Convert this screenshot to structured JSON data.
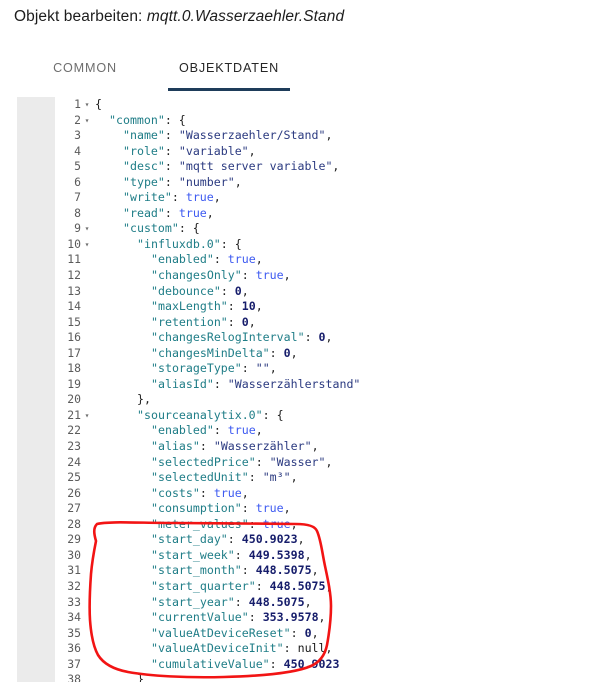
{
  "dialog": {
    "title_prefix": "Objekt bearbeiten:",
    "object_id": "mqtt.0.Wasserzaehler.Stand"
  },
  "tabs": [
    {
      "label": "COMMON",
      "active": false
    },
    {
      "label": "OBJEKTDATEN",
      "active": true
    }
  ],
  "colors": {
    "accent_underline": "#1e3c5a",
    "annotation_red": "#f21414",
    "gutter_bg": "#ebebeb",
    "json_key": "#1f7d87",
    "json_string": "#2b3a80",
    "json_number": "#161d6b",
    "json_boolean": "#3d5af1"
  },
  "editor": {
    "language": "json",
    "line_count": 38,
    "lines": [
      {
        "n": 1,
        "fold": true,
        "indent": 0,
        "tokens": [
          {
            "t": "punct",
            "v": "{"
          }
        ]
      },
      {
        "n": 2,
        "fold": true,
        "indent": 1,
        "tokens": [
          {
            "t": "key",
            "v": "\"common\""
          },
          {
            "t": "punct",
            "v": ": {"
          }
        ]
      },
      {
        "n": 3,
        "fold": false,
        "indent": 2,
        "tokens": [
          {
            "t": "key",
            "v": "\"name\""
          },
          {
            "t": "punct",
            "v": ": "
          },
          {
            "t": "str",
            "v": "\"Wasserzaehler/Stand\""
          },
          {
            "t": "punct",
            "v": ","
          }
        ]
      },
      {
        "n": 4,
        "fold": false,
        "indent": 2,
        "tokens": [
          {
            "t": "key",
            "v": "\"role\""
          },
          {
            "t": "punct",
            "v": ": "
          },
          {
            "t": "str",
            "v": "\"variable\""
          },
          {
            "t": "punct",
            "v": ","
          }
        ]
      },
      {
        "n": 5,
        "fold": false,
        "indent": 2,
        "tokens": [
          {
            "t": "key",
            "v": "\"desc\""
          },
          {
            "t": "punct",
            "v": ": "
          },
          {
            "t": "str",
            "v": "\"mqtt server variable\""
          },
          {
            "t": "punct",
            "v": ","
          }
        ]
      },
      {
        "n": 6,
        "fold": false,
        "indent": 2,
        "tokens": [
          {
            "t": "key",
            "v": "\"type\""
          },
          {
            "t": "punct",
            "v": ": "
          },
          {
            "t": "str",
            "v": "\"number\""
          },
          {
            "t": "punct",
            "v": ","
          }
        ]
      },
      {
        "n": 7,
        "fold": false,
        "indent": 2,
        "tokens": [
          {
            "t": "key",
            "v": "\"write\""
          },
          {
            "t": "punct",
            "v": ": "
          },
          {
            "t": "bool",
            "v": "true"
          },
          {
            "t": "punct",
            "v": ","
          }
        ]
      },
      {
        "n": 8,
        "fold": false,
        "indent": 2,
        "tokens": [
          {
            "t": "key",
            "v": "\"read\""
          },
          {
            "t": "punct",
            "v": ": "
          },
          {
            "t": "bool",
            "v": "true"
          },
          {
            "t": "punct",
            "v": ","
          }
        ]
      },
      {
        "n": 9,
        "fold": true,
        "indent": 2,
        "tokens": [
          {
            "t": "key",
            "v": "\"custom\""
          },
          {
            "t": "punct",
            "v": ": {"
          }
        ]
      },
      {
        "n": 10,
        "fold": true,
        "indent": 3,
        "tokens": [
          {
            "t": "key",
            "v": "\"influxdb.0\""
          },
          {
            "t": "punct",
            "v": ": {"
          }
        ]
      },
      {
        "n": 11,
        "fold": false,
        "indent": 4,
        "tokens": [
          {
            "t": "key",
            "v": "\"enabled\""
          },
          {
            "t": "punct",
            "v": ": "
          },
          {
            "t": "bool",
            "v": "true"
          },
          {
            "t": "punct",
            "v": ","
          }
        ]
      },
      {
        "n": 12,
        "fold": false,
        "indent": 4,
        "tokens": [
          {
            "t": "key",
            "v": "\"changesOnly\""
          },
          {
            "t": "punct",
            "v": ": "
          },
          {
            "t": "bool",
            "v": "true"
          },
          {
            "t": "punct",
            "v": ","
          }
        ]
      },
      {
        "n": 13,
        "fold": false,
        "indent": 4,
        "tokens": [
          {
            "t": "key",
            "v": "\"debounce\""
          },
          {
            "t": "punct",
            "v": ": "
          },
          {
            "t": "num",
            "v": "0"
          },
          {
            "t": "punct",
            "v": ","
          }
        ]
      },
      {
        "n": 14,
        "fold": false,
        "indent": 4,
        "tokens": [
          {
            "t": "key",
            "v": "\"maxLength\""
          },
          {
            "t": "punct",
            "v": ": "
          },
          {
            "t": "num",
            "v": "10"
          },
          {
            "t": "punct",
            "v": ","
          }
        ]
      },
      {
        "n": 15,
        "fold": false,
        "indent": 4,
        "tokens": [
          {
            "t": "key",
            "v": "\"retention\""
          },
          {
            "t": "punct",
            "v": ": "
          },
          {
            "t": "num",
            "v": "0"
          },
          {
            "t": "punct",
            "v": ","
          }
        ]
      },
      {
        "n": 16,
        "fold": false,
        "indent": 4,
        "tokens": [
          {
            "t": "key",
            "v": "\"changesRelogInterval\""
          },
          {
            "t": "punct",
            "v": ": "
          },
          {
            "t": "num",
            "v": "0"
          },
          {
            "t": "punct",
            "v": ","
          }
        ]
      },
      {
        "n": 17,
        "fold": false,
        "indent": 4,
        "tokens": [
          {
            "t": "key",
            "v": "\"changesMinDelta\""
          },
          {
            "t": "punct",
            "v": ": "
          },
          {
            "t": "num",
            "v": "0"
          },
          {
            "t": "punct",
            "v": ","
          }
        ]
      },
      {
        "n": 18,
        "fold": false,
        "indent": 4,
        "tokens": [
          {
            "t": "key",
            "v": "\"storageType\""
          },
          {
            "t": "punct",
            "v": ": "
          },
          {
            "t": "str",
            "v": "\"\""
          },
          {
            "t": "punct",
            "v": ","
          }
        ]
      },
      {
        "n": 19,
        "fold": false,
        "indent": 4,
        "tokens": [
          {
            "t": "key",
            "v": "\"aliasId\""
          },
          {
            "t": "punct",
            "v": ": "
          },
          {
            "t": "str",
            "v": "\"Wasserzählerstand\""
          }
        ]
      },
      {
        "n": 20,
        "fold": false,
        "indent": 3,
        "tokens": [
          {
            "t": "punct",
            "v": "},"
          }
        ]
      },
      {
        "n": 21,
        "fold": true,
        "indent": 3,
        "tokens": [
          {
            "t": "key",
            "v": "\"sourceanalytix.0\""
          },
          {
            "t": "punct",
            "v": ": {"
          }
        ]
      },
      {
        "n": 22,
        "fold": false,
        "indent": 4,
        "tokens": [
          {
            "t": "key",
            "v": "\"enabled\""
          },
          {
            "t": "punct",
            "v": ": "
          },
          {
            "t": "bool",
            "v": "true"
          },
          {
            "t": "punct",
            "v": ","
          }
        ]
      },
      {
        "n": 23,
        "fold": false,
        "indent": 4,
        "tokens": [
          {
            "t": "key",
            "v": "\"alias\""
          },
          {
            "t": "punct",
            "v": ": "
          },
          {
            "t": "str",
            "v": "\"Wasserzähler\""
          },
          {
            "t": "punct",
            "v": ","
          }
        ]
      },
      {
        "n": 24,
        "fold": false,
        "indent": 4,
        "tokens": [
          {
            "t": "key",
            "v": "\"selectedPrice\""
          },
          {
            "t": "punct",
            "v": ": "
          },
          {
            "t": "str",
            "v": "\"Wasser\""
          },
          {
            "t": "punct",
            "v": ","
          }
        ]
      },
      {
        "n": 25,
        "fold": false,
        "indent": 4,
        "tokens": [
          {
            "t": "key",
            "v": "\"selectedUnit\""
          },
          {
            "t": "punct",
            "v": ": "
          },
          {
            "t": "str",
            "v": "\"m³\""
          },
          {
            "t": "punct",
            "v": ","
          }
        ]
      },
      {
        "n": 26,
        "fold": false,
        "indent": 4,
        "tokens": [
          {
            "t": "key",
            "v": "\"costs\""
          },
          {
            "t": "punct",
            "v": ": "
          },
          {
            "t": "bool",
            "v": "true"
          },
          {
            "t": "punct",
            "v": ","
          }
        ]
      },
      {
        "n": 27,
        "fold": false,
        "indent": 4,
        "tokens": [
          {
            "t": "key",
            "v": "\"consumption\""
          },
          {
            "t": "punct",
            "v": ": "
          },
          {
            "t": "bool",
            "v": "true"
          },
          {
            "t": "punct",
            "v": ","
          }
        ]
      },
      {
        "n": 28,
        "fold": false,
        "indent": 4,
        "tokens": [
          {
            "t": "key",
            "v": "\"meter_values\""
          },
          {
            "t": "punct",
            "v": ": "
          },
          {
            "t": "bool",
            "v": "true"
          },
          {
            "t": "punct",
            "v": ","
          }
        ]
      },
      {
        "n": 29,
        "fold": false,
        "indent": 4,
        "tokens": [
          {
            "t": "key",
            "v": "\"start_day\""
          },
          {
            "t": "punct",
            "v": ": "
          },
          {
            "t": "num",
            "v": "450.9023"
          },
          {
            "t": "punct",
            "v": ","
          }
        ]
      },
      {
        "n": 30,
        "fold": false,
        "indent": 4,
        "tokens": [
          {
            "t": "key",
            "v": "\"start_week\""
          },
          {
            "t": "punct",
            "v": ": "
          },
          {
            "t": "num",
            "v": "449.5398"
          },
          {
            "t": "punct",
            "v": ","
          }
        ]
      },
      {
        "n": 31,
        "fold": false,
        "indent": 4,
        "tokens": [
          {
            "t": "key",
            "v": "\"start_month\""
          },
          {
            "t": "punct",
            "v": ": "
          },
          {
            "t": "num",
            "v": "448.5075"
          },
          {
            "t": "punct",
            "v": ","
          }
        ]
      },
      {
        "n": 32,
        "fold": false,
        "indent": 4,
        "tokens": [
          {
            "t": "key",
            "v": "\"start_quarter\""
          },
          {
            "t": "punct",
            "v": ": "
          },
          {
            "t": "num",
            "v": "448.5075"
          },
          {
            "t": "punct",
            "v": ","
          }
        ]
      },
      {
        "n": 33,
        "fold": false,
        "indent": 4,
        "tokens": [
          {
            "t": "key",
            "v": "\"start_year\""
          },
          {
            "t": "punct",
            "v": ": "
          },
          {
            "t": "num",
            "v": "448.5075"
          },
          {
            "t": "punct",
            "v": ","
          }
        ]
      },
      {
        "n": 34,
        "fold": false,
        "indent": 4,
        "tokens": [
          {
            "t": "key",
            "v": "\"currentValue\""
          },
          {
            "t": "punct",
            "v": ": "
          },
          {
            "t": "num",
            "v": "353.9578"
          },
          {
            "t": "punct",
            "v": ","
          }
        ]
      },
      {
        "n": 35,
        "fold": false,
        "indent": 4,
        "tokens": [
          {
            "t": "key",
            "v": "\"valueAtDeviceReset\""
          },
          {
            "t": "punct",
            "v": ": "
          },
          {
            "t": "num",
            "v": "0"
          },
          {
            "t": "punct",
            "v": ","
          }
        ]
      },
      {
        "n": 36,
        "fold": false,
        "indent": 4,
        "tokens": [
          {
            "t": "key",
            "v": "\"valueAtDeviceInit\""
          },
          {
            "t": "punct",
            "v": ": "
          },
          {
            "t": "null",
            "v": "null"
          },
          {
            "t": "punct",
            "v": ","
          }
        ]
      },
      {
        "n": 37,
        "fold": false,
        "indent": 4,
        "tokens": [
          {
            "t": "key",
            "v": "\"cumulativeValue\""
          },
          {
            "t": "punct",
            "v": ": "
          },
          {
            "t": "num",
            "v": "450.9023"
          }
        ]
      },
      {
        "n": 38,
        "fold": false,
        "indent": 3,
        "tokens": [
          {
            "t": "punct",
            "v": "}"
          }
        ]
      }
    ]
  },
  "annotation": {
    "shape": "hand-drawn-circle",
    "color": "#f21414",
    "covers_lines": [
      29,
      37
    ]
  }
}
